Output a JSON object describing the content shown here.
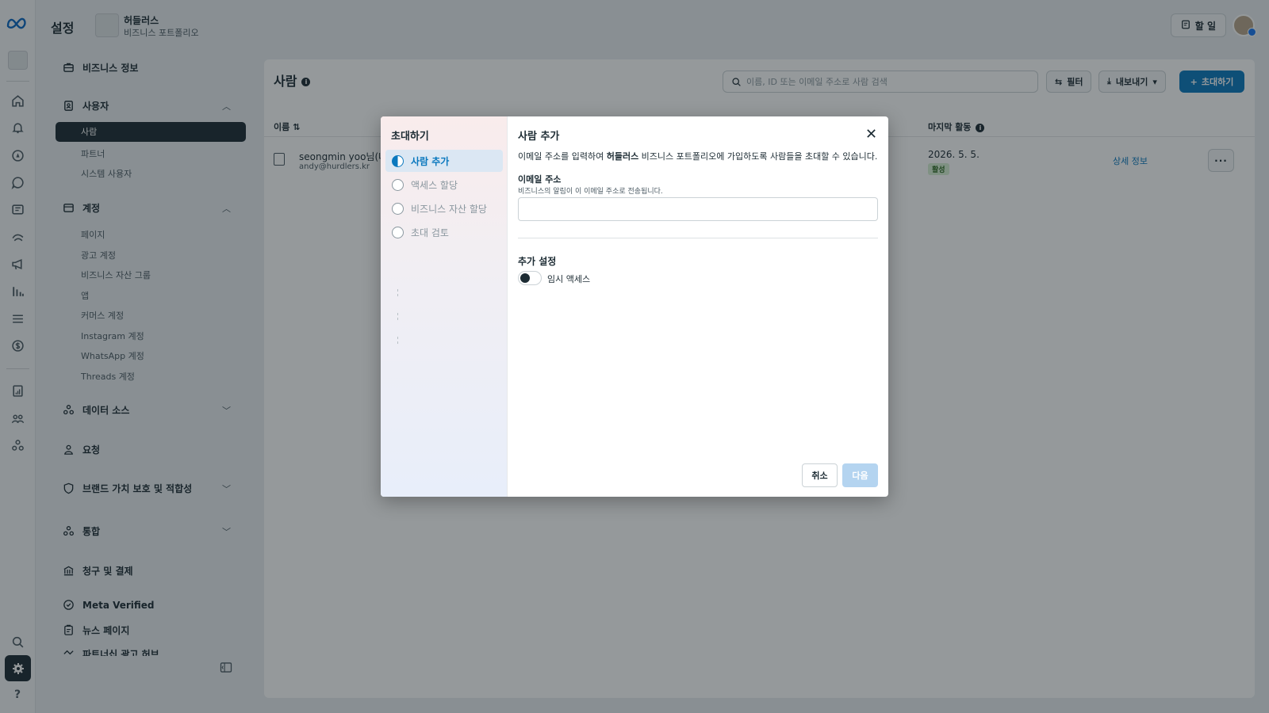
{
  "topbar": {
    "title": "설정",
    "business_name": "허들러스",
    "business_sub": "비즈니스 포트폴리오",
    "todo_label": "할 일"
  },
  "sidebar": {
    "business_info": "비즈니스 정보",
    "users": {
      "label": "사용자",
      "items": [
        "사람",
        "파트너",
        "시스템 사용자"
      ]
    },
    "accounts": {
      "label": "계정",
      "items": [
        "페이지",
        "광고 계정",
        "비즈니스 자산 그룹",
        "앱",
        "커머스 계정",
        "Instagram 계정",
        "WhatsApp 계정",
        "Threads 계정"
      ]
    },
    "data_sources": "데이터 소스",
    "requests": "요청",
    "brand_safety": "브랜드 가치 보호 및 적합성",
    "integrations": "통합",
    "billing": "청구 및 결제",
    "meta_verified": "Meta Verified",
    "news_page": "뉴스 페이지",
    "partnership": "파트너십 광고 허브"
  },
  "main": {
    "title": "사람",
    "search_placeholder": "이름, ID 또는 이메일 주소로 사람 검색",
    "filter_label": "필터",
    "export_label": "내보내기",
    "invite_label": "초대하기",
    "col_name": "이름",
    "col_last_activity": "마지막 활동",
    "row": {
      "name": "seongmin yoo님(나",
      "email": "andy@hurdlers.kr",
      "date": "2026. 5. 5.",
      "status": "활성",
      "details_link": "상세 정보"
    }
  },
  "modal": {
    "steps_title": "초대하기",
    "steps": [
      "사람 추가",
      "액세스 할당",
      "비즈니스 자산 할당",
      "초대 검토"
    ],
    "title": "사람 추가",
    "desc_prefix": "이메일 주소를 입력하여 ",
    "desc_business": "허들러스",
    "desc_suffix": " 비즈니스 포트폴리오에 가입하도록 사람들을 초대할 수 있습니다.",
    "email_label": "이메일 주소",
    "email_hint": "비즈니스의 알림이 이 이메일 주소로 전송됩니다.",
    "email_value": "",
    "extra_settings": "추가 설정",
    "temp_access": "임시 액세스",
    "cancel": "취소",
    "next": "다음"
  },
  "colors": {
    "primary": "#0a78be",
    "dark": "#1c2b33",
    "active_badge_bg": "#d8f0d3"
  }
}
